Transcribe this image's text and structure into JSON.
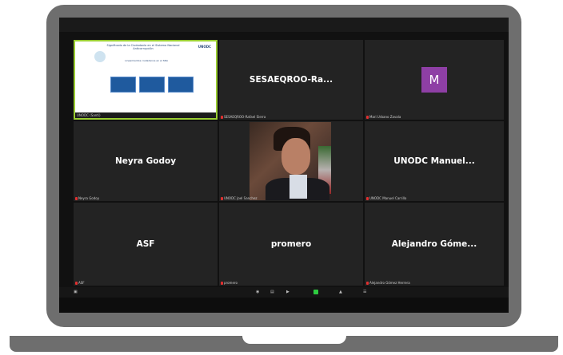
{
  "participants": [
    {
      "name": "",
      "label": "UNODC (Santi)",
      "type": "slide"
    },
    {
      "name": "SESAEQROO-Ra...",
      "label": "SESAEQROO-Rafael Sierra",
      "type": "name"
    },
    {
      "name": "",
      "label": "Mari Urbano Zavala",
      "type": "avatar",
      "avatar": "M"
    },
    {
      "name": "Neyra Godoy",
      "label": "Neyra Godoy",
      "type": "name"
    },
    {
      "name": "",
      "label": "UNODC Joel Sanchez",
      "type": "video"
    },
    {
      "name": "UNODC  Manuel...",
      "label": "UNODC Manuel Carrillo",
      "type": "name"
    },
    {
      "name": "ASF",
      "label": "ASF",
      "type": "name"
    },
    {
      "name": "promero",
      "label": "promero",
      "type": "name"
    },
    {
      "name": "Alejandro  Góme...",
      "label": "Alejandro Gómez Herrera",
      "type": "name"
    }
  ],
  "slide": {
    "title": "Significado de la Ciudadanía en el Sistema Nacional Anticorrupción",
    "subtitle": "Lineamientos ciudadanos en el SNA",
    "logo": "UNODC"
  },
  "toolbar": {
    "left": "▣",
    "items": [
      "◉",
      "▤",
      "▶",
      "■",
      "▲",
      "☰"
    ]
  },
  "colors": {
    "tile_bg": "#232323",
    "active_border": "#9acd32",
    "avatar_bg": "#8e3fa5",
    "muted_mic": "#e03030"
  }
}
